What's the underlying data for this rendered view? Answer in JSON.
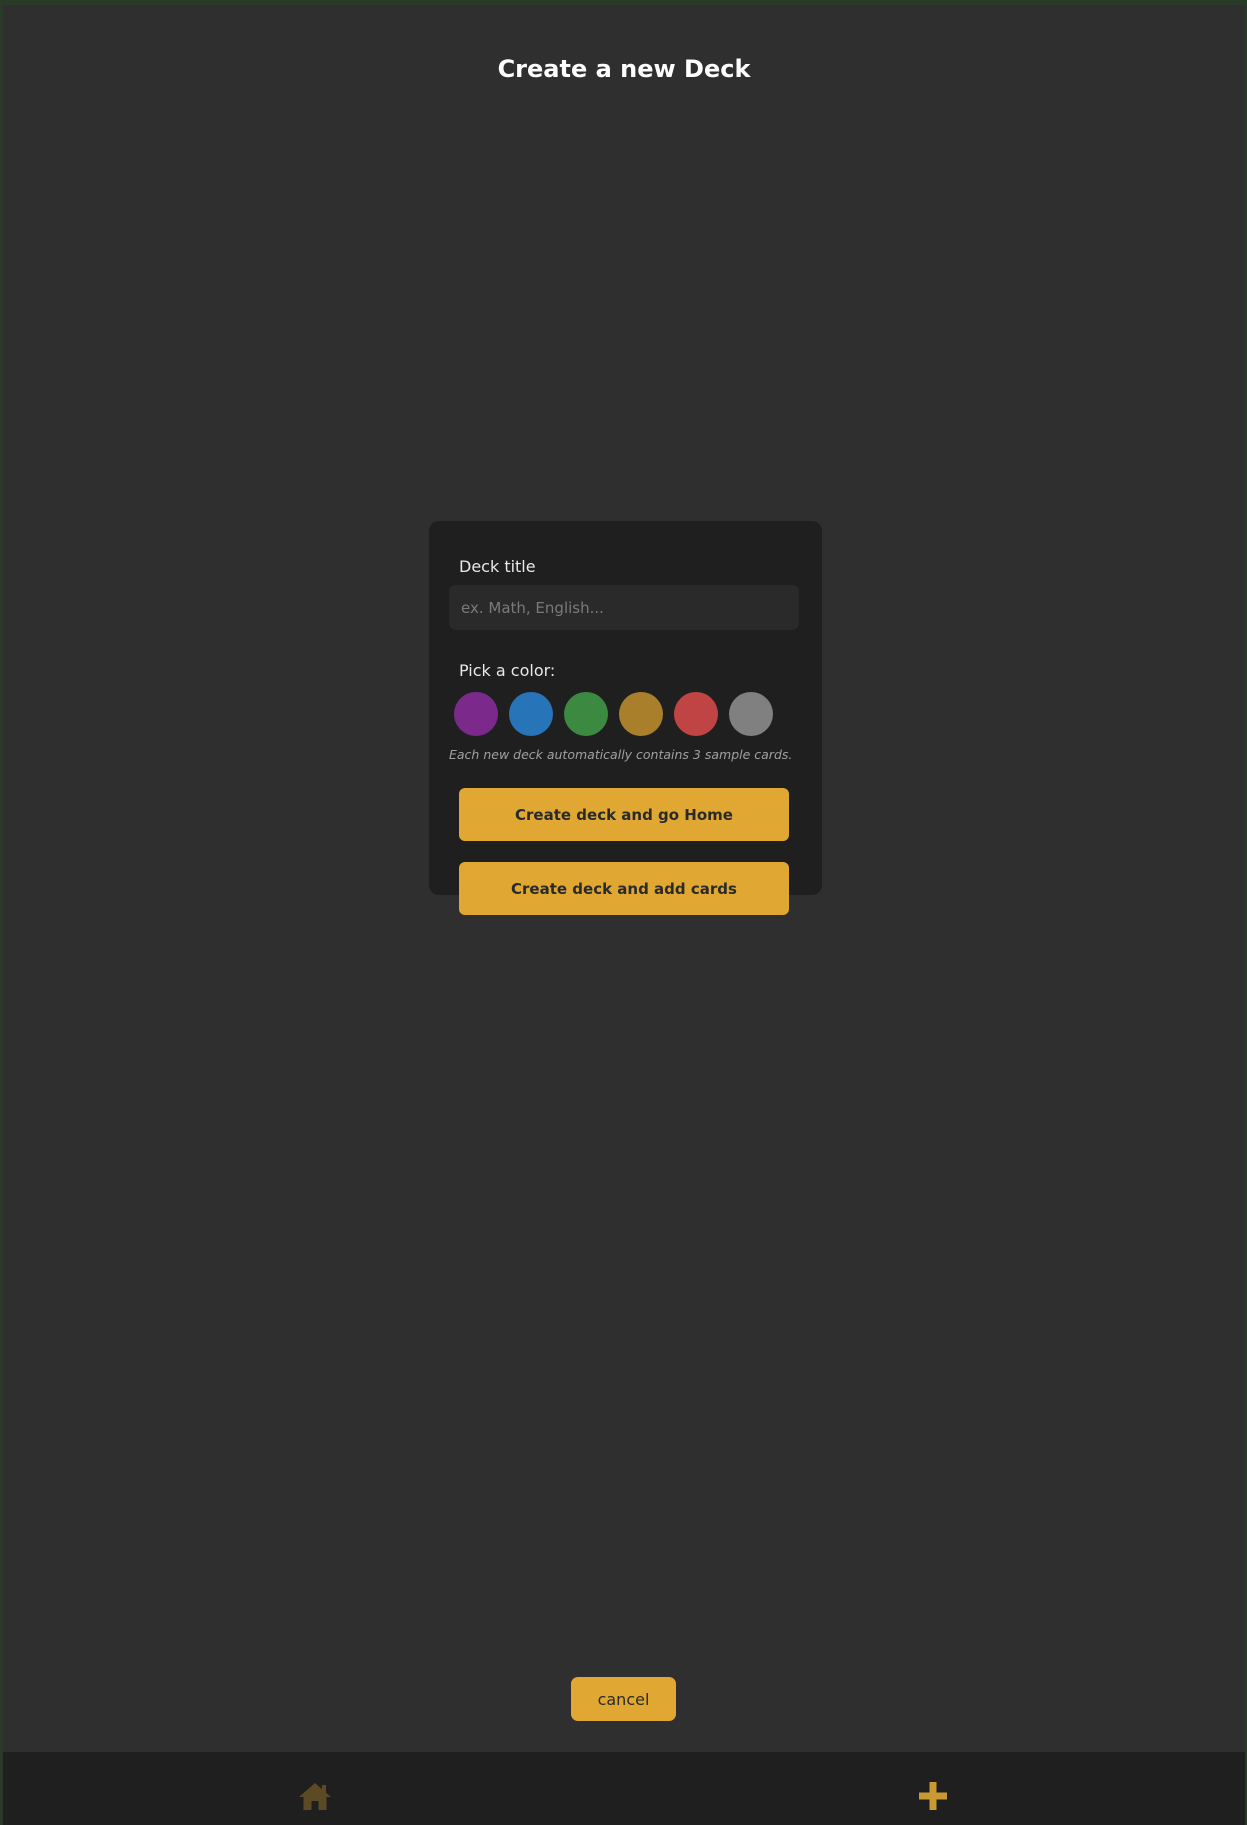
{
  "header": {
    "title": "Create a new Deck"
  },
  "form": {
    "deck_title_label": "Deck title",
    "deck_title_placeholder": "ex. Math, English...",
    "deck_title_value": "",
    "pick_color_label": "Pick a color:",
    "colors": [
      {
        "name": "purple",
        "hex": "#7b2a8c"
      },
      {
        "name": "blue",
        "hex": "#2874b8"
      },
      {
        "name": "green",
        "hex": "#3c8a42"
      },
      {
        "name": "gold",
        "hex": "#a97f2c"
      },
      {
        "name": "red",
        "hex": "#c04444"
      },
      {
        "name": "gray",
        "hex": "#808080"
      }
    ],
    "note": "Each new deck automatically contains 3 sample cards.",
    "create_home_label": "Create deck and go Home",
    "create_add_cards_label": "Create deck and add cards"
  },
  "cancel_label": "cancel",
  "nav": {
    "home_icon": "home-icon",
    "add_icon": "plus-icon"
  },
  "theme": {
    "accent": "#e0a832",
    "background": "#2f2f2f",
    "card": "#1f1f1f"
  }
}
